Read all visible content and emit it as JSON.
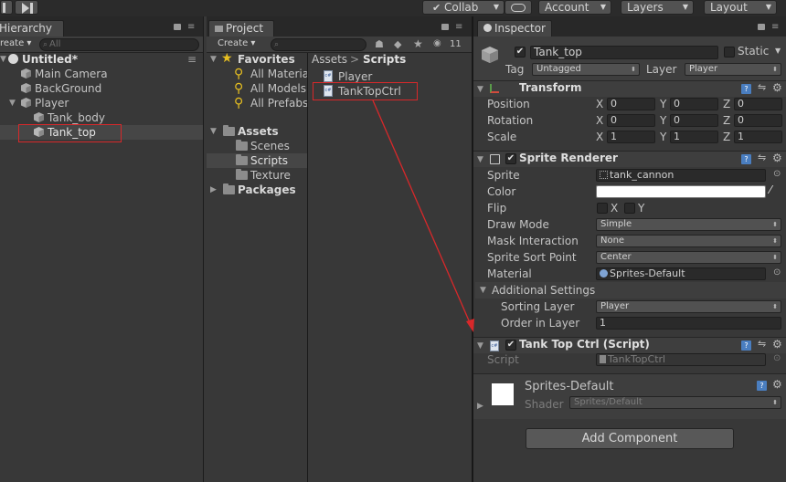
{
  "toolbar": {
    "collab": "Collab",
    "account": "Account",
    "layers": "Layers",
    "layout": "Layout"
  },
  "hierarchy": {
    "tab": "Hierarchy",
    "create": "reate",
    "search_placeholder": "All",
    "scene": "Untitled*",
    "items": [
      "Main Camera",
      "BackGround",
      "Player",
      "Tank_body",
      "Tank_top"
    ]
  },
  "project": {
    "tab": "Project",
    "create": "Create",
    "hidden_count": "11",
    "favorites": "Favorites",
    "fav_items": [
      "All Materia",
      "All Models",
      "All Prefabs"
    ],
    "assets": "Assets",
    "asset_folders": [
      "Scenes",
      "Scripts",
      "Texture"
    ],
    "packages": "Packages",
    "breadcrumb": [
      "Assets",
      "Scripts"
    ],
    "files": [
      "Player",
      "TankTopCtrl"
    ]
  },
  "inspector": {
    "tab": "Inspector",
    "object_name": "Tank_top",
    "static_label": "Static",
    "tag_label": "Tag",
    "tag_value": "Untagged",
    "layer_label": "Layer",
    "layer_value": "Player",
    "transform": {
      "title": "Transform",
      "position_label": "Position",
      "rotation_label": "Rotation",
      "scale_label": "Scale",
      "axis_x": "X",
      "axis_y": "Y",
      "axis_z": "Z",
      "position": [
        "0",
        "0",
        "0"
      ],
      "rotation": [
        "0",
        "0",
        "0"
      ],
      "scale": [
        "1",
        "1",
        "1"
      ]
    },
    "sprite_renderer": {
      "title": "Sprite Renderer",
      "sprite_label": "Sprite",
      "sprite_value": "tank_cannon",
      "color_label": "Color",
      "color_value": "#ffffff",
      "flip_label": "Flip",
      "flip_x": "X",
      "flip_y": "Y",
      "draw_mode_label": "Draw Mode",
      "draw_mode_value": "Simple",
      "mask_label": "Mask Interaction",
      "mask_value": "None",
      "sort_point_label": "Sprite Sort Point",
      "sort_point_value": "Center",
      "material_label": "Material",
      "material_value": "Sprites-Default",
      "additional": "Additional Settings",
      "sorting_layer_label": "Sorting Layer",
      "sorting_layer_value": "Player",
      "order_label": "Order in Layer",
      "order_value": "1"
    },
    "script_comp": {
      "title": "Tank Top Ctrl (Script)",
      "script_label": "Script",
      "script_value": "TankTopCtrl"
    },
    "material": {
      "name": "Sprites-Default",
      "shader_label": "Shader",
      "shader_value": "Sprites/Default"
    },
    "add_component": "Add Component"
  },
  "colors": {
    "highlight_box": "#d8282a",
    "arrow": "#d8282a"
  }
}
